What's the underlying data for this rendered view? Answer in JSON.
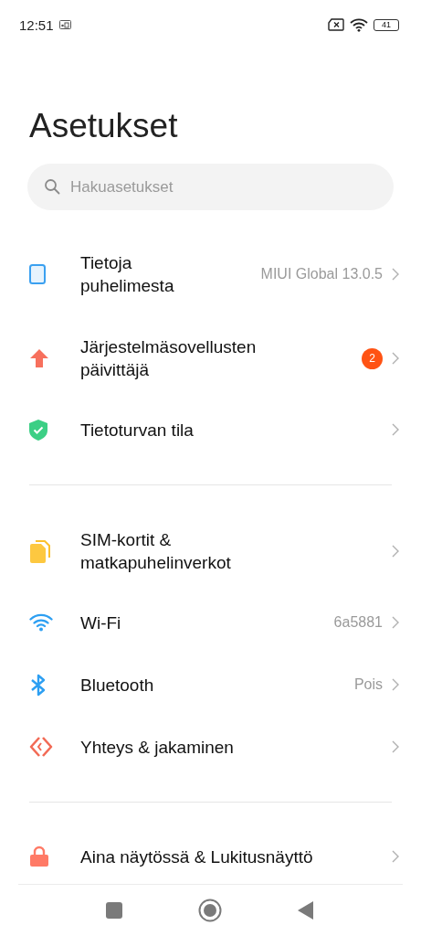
{
  "status_bar": {
    "time": "12:51",
    "battery": "41"
  },
  "title": "Asetukset",
  "search": {
    "placeholder": "Hakuasetukset"
  },
  "groups": [
    [
      {
        "kind": "phone",
        "label": [
          "Tietoja",
          "puhelimesta"
        ],
        "value": "MIUI Global 13.0.5"
      },
      {
        "kind": "update",
        "label": [
          "Järjestelmäsovellusten",
          "päivittäjä"
        ],
        "badge": "2"
      },
      {
        "kind": "security",
        "label": [
          "Tietoturvan tila"
        ]
      }
    ],
    [
      {
        "kind": "sim",
        "label": [
          "SIM-kortit &",
          "matkapuhelinverkot"
        ]
      },
      {
        "kind": "wifi",
        "label": [
          "Wi-Fi"
        ],
        "value": "6a5881"
      },
      {
        "kind": "bluetooth",
        "label": [
          "Bluetooth"
        ],
        "value": "Pois"
      },
      {
        "kind": "share",
        "label": [
          "Yhteys & jakaminen"
        ]
      }
    ],
    [
      {
        "kind": "lock",
        "label": [
          "Aina näytössä & Lukitusnäyttö"
        ]
      }
    ]
  ]
}
